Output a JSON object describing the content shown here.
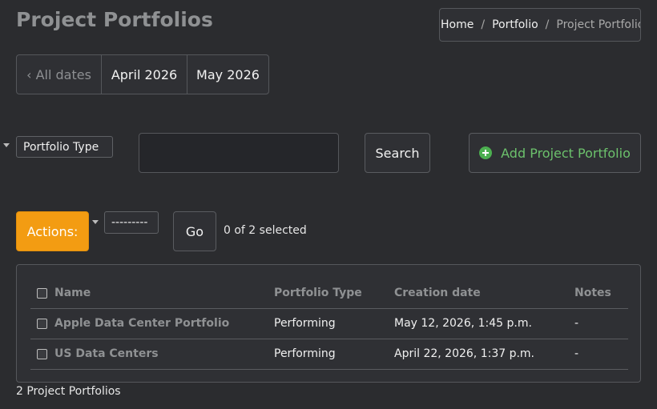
{
  "page": {
    "title": "Project Portfolios"
  },
  "breadcrumb": {
    "home": "Home",
    "portfolio": "Portfolio",
    "current": "Project Portfolios",
    "separator": "/"
  },
  "date_filter": {
    "all_dates": "‹ All dates",
    "items": [
      "April 2026",
      "May 2026"
    ]
  },
  "filters": {
    "portfolio_type_label": "Portfolio Type",
    "search_value": "",
    "search_button": "Search",
    "add_button": "Add Project Portfolio"
  },
  "actions": {
    "label": "Actions:",
    "selected_option": "---------",
    "go_button": "Go",
    "selection_count": "0 of 2 selected"
  },
  "table": {
    "columns": [
      "Name",
      "Portfolio Type",
      "Creation date",
      "Notes"
    ],
    "rows": [
      {
        "name": "Apple Data Center Portfolio",
        "type": "Performing",
        "created": "May 12, 2026, 1:45 p.m.",
        "notes": "-"
      },
      {
        "name": "US Data Centers",
        "type": "Performing",
        "created": "April 22, 2026, 1:37 p.m.",
        "notes": "-"
      }
    ]
  },
  "footer": {
    "count": "2 Project Portfolios"
  },
  "colors": {
    "accent_orange": "#f39c12",
    "success_green": "#6cc16c",
    "background": "#2b2c2f"
  },
  "icons": {
    "add": "plus-circle-icon",
    "dropdown": "caret-down-icon"
  }
}
